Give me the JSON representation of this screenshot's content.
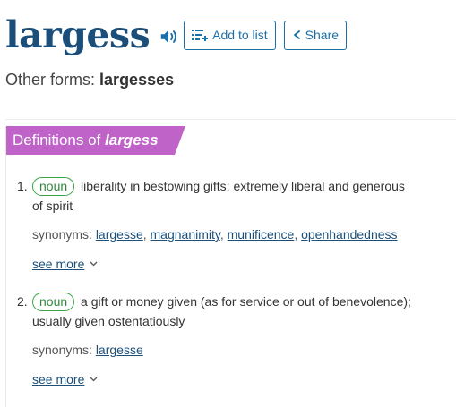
{
  "entry": {
    "word": "largess",
    "add_to_list_label": "Add to list",
    "share_label": "Share"
  },
  "other_forms": {
    "label": "Other forms:",
    "value": "largesses"
  },
  "definitions": {
    "prefix": "Definitions of",
    "word": "largess",
    "senses": [
      {
        "number": "1.",
        "pos": "noun",
        "definition_line1": "liberality in bestowing gifts; extremely liberal and generous",
        "definition_line2": "of spirit",
        "synonyms_label": "synonyms:",
        "synonyms": [
          "largesse",
          "magnanimity",
          "munificence",
          "openhandedness"
        ],
        "see_more": "see more"
      },
      {
        "number": "2.",
        "pos": "noun",
        "definition_line1": "a gift or money given (as for service or out of benevolence);",
        "definition_line2": "usually given ostentatiously",
        "synonyms_label": "synonyms:",
        "synonyms": [
          "largesse"
        ],
        "see_more": "see more"
      }
    ]
  },
  "colors": {
    "headword": "#1b4f7a",
    "link": "#1a6fa8",
    "banner": "#bf63c9",
    "pos_tag": "#3aa346"
  },
  "icons": {
    "audio": "speaker-icon",
    "add_to_list": "list-add-icon",
    "share": "share-icon",
    "see_more": "chevron-down-icon"
  }
}
